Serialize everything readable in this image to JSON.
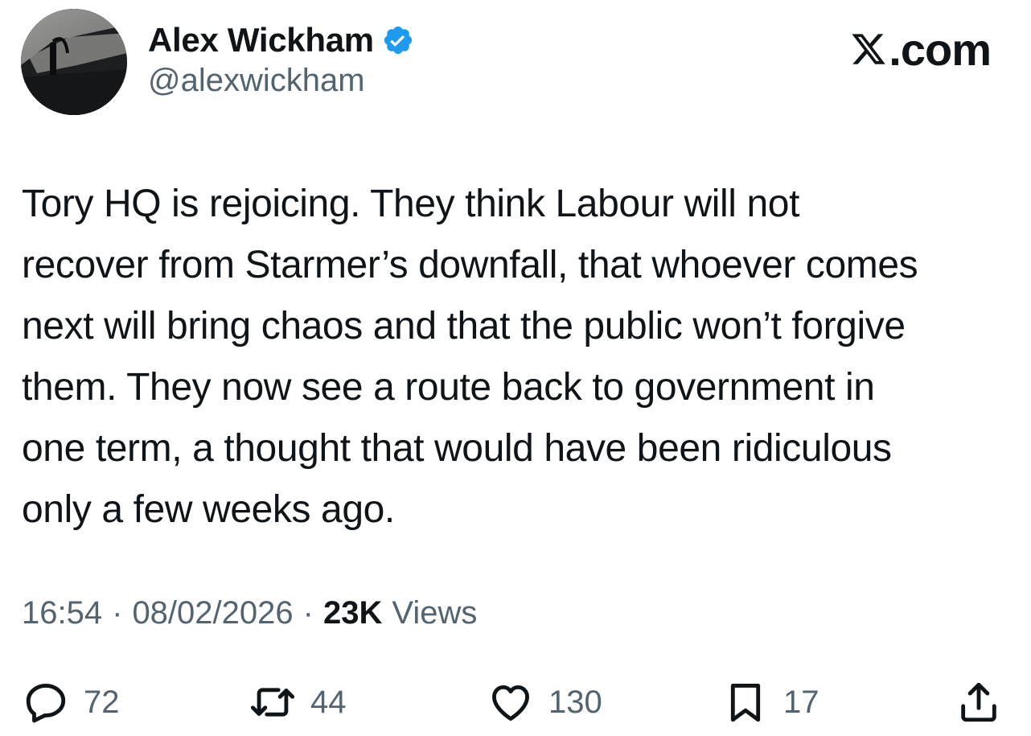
{
  "author": {
    "display_name": "Alex Wickham",
    "handle": "@alexwickham",
    "verified": true,
    "verified_color": "#1d9bf0"
  },
  "branding": {
    "site": ".com",
    "icon": "x-logo-icon"
  },
  "tweet": {
    "text": "Tory HQ is rejoicing. They think Labour will not\nrecover from Starmer’s downfall, that whoever comes\nnext will bring chaos and that the public won’t forgive\nthem. They now see a route back to government in\none term, a thought that would have been ridiculous\nonly a few weeks ago."
  },
  "meta": {
    "time": "16:54",
    "separator": "·",
    "date": "08/02/2026",
    "views_count": "23K",
    "views_label": "Views"
  },
  "actions": {
    "replies": "72",
    "reposts": "44",
    "likes": "130",
    "bookmarks": "17"
  },
  "colors": {
    "text_primary": "#0f1419",
    "text_secondary": "#536471"
  }
}
